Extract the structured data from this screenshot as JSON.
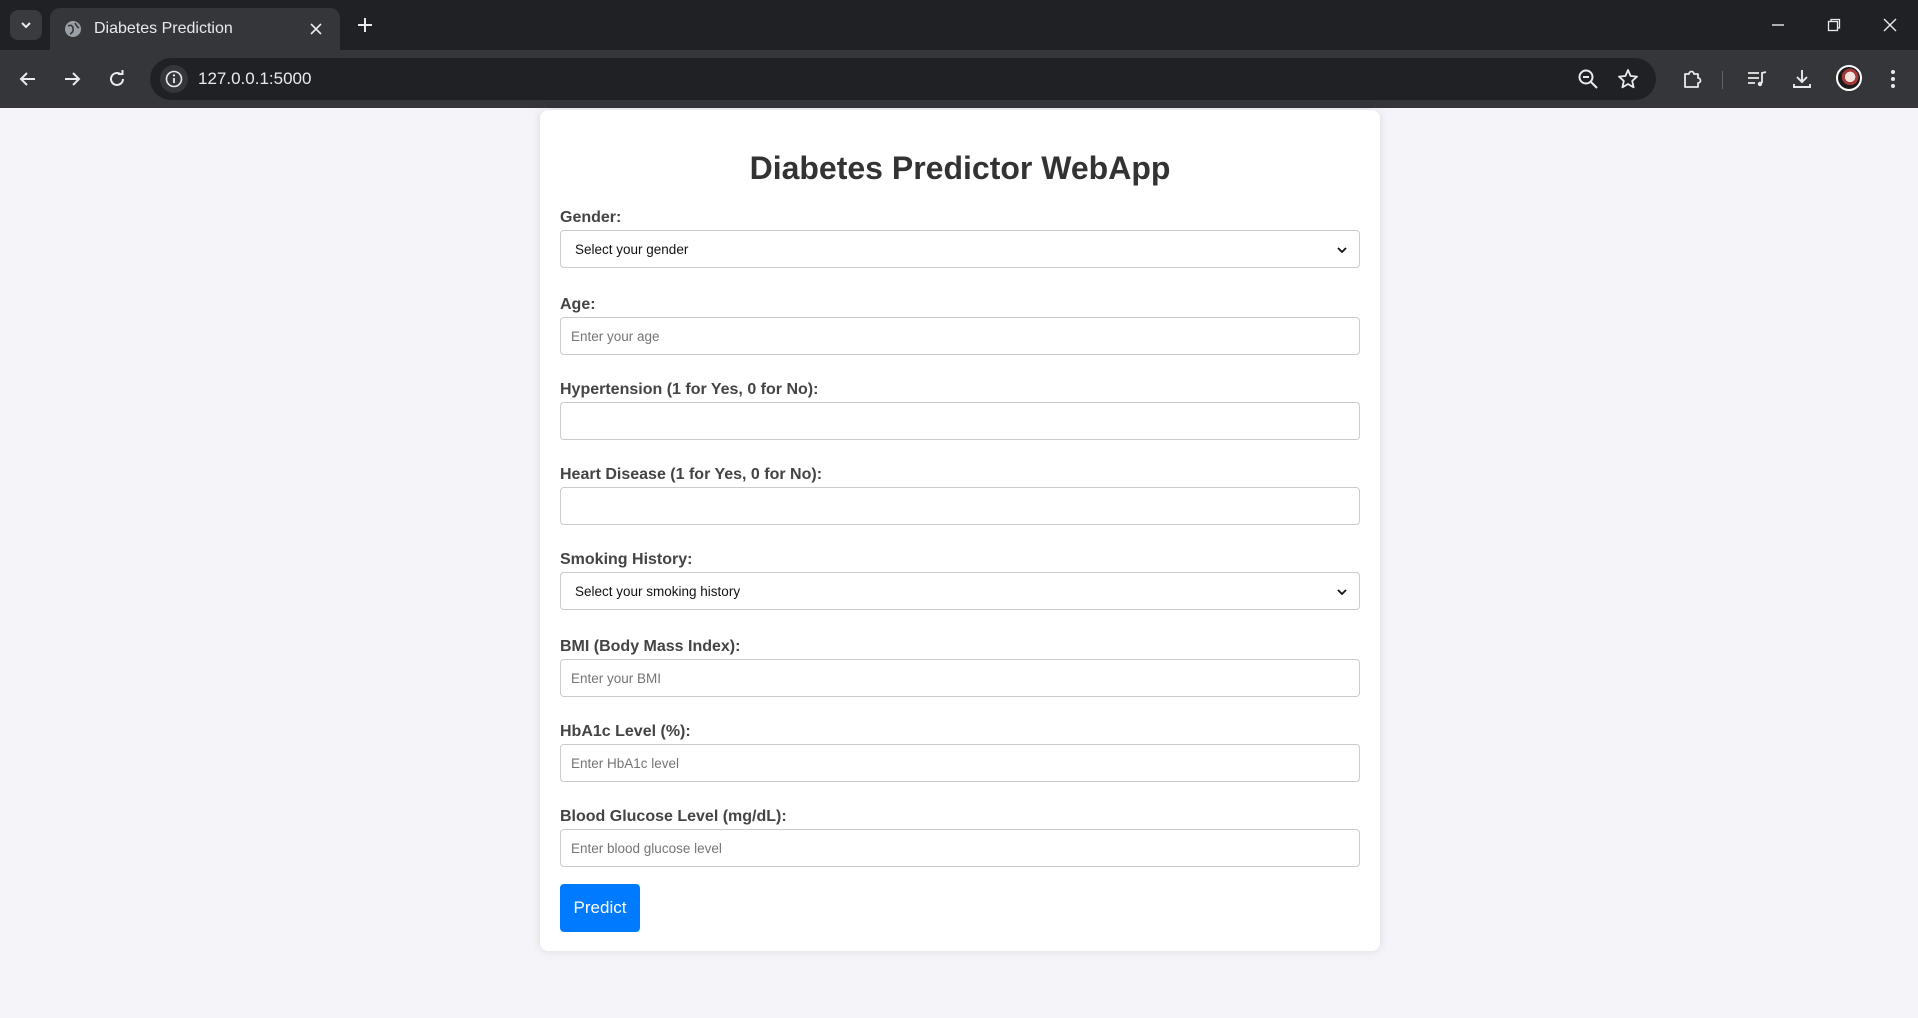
{
  "browser": {
    "tab_title": "Diabetes Prediction",
    "url": "127.0.0.1:5000"
  },
  "page": {
    "title": "Diabetes Predictor WebApp",
    "accent_color": "#007bff",
    "fields": {
      "gender": {
        "label": "Gender:",
        "selected": "Select your gender"
      },
      "age": {
        "label": "Age:",
        "placeholder": "Enter your age",
        "value": ""
      },
      "hypertension": {
        "label": "Hypertension (1 for Yes, 0 for No):",
        "value": ""
      },
      "heart_disease": {
        "label": "Heart Disease (1 for Yes, 0 for No):",
        "value": ""
      },
      "smoking": {
        "label": "Smoking History:",
        "selected": "Select your smoking history"
      },
      "bmi": {
        "label": "BMI (Body Mass Index):",
        "placeholder": "Enter your BMI",
        "value": ""
      },
      "hba1c": {
        "label": "HbA1c Level (%):",
        "placeholder": "Enter HbA1c level",
        "value": ""
      },
      "glucose": {
        "label": "Blood Glucose Level (mg/dL):",
        "placeholder": "Enter blood glucose level",
        "value": ""
      }
    },
    "submit_label": "Predict"
  }
}
